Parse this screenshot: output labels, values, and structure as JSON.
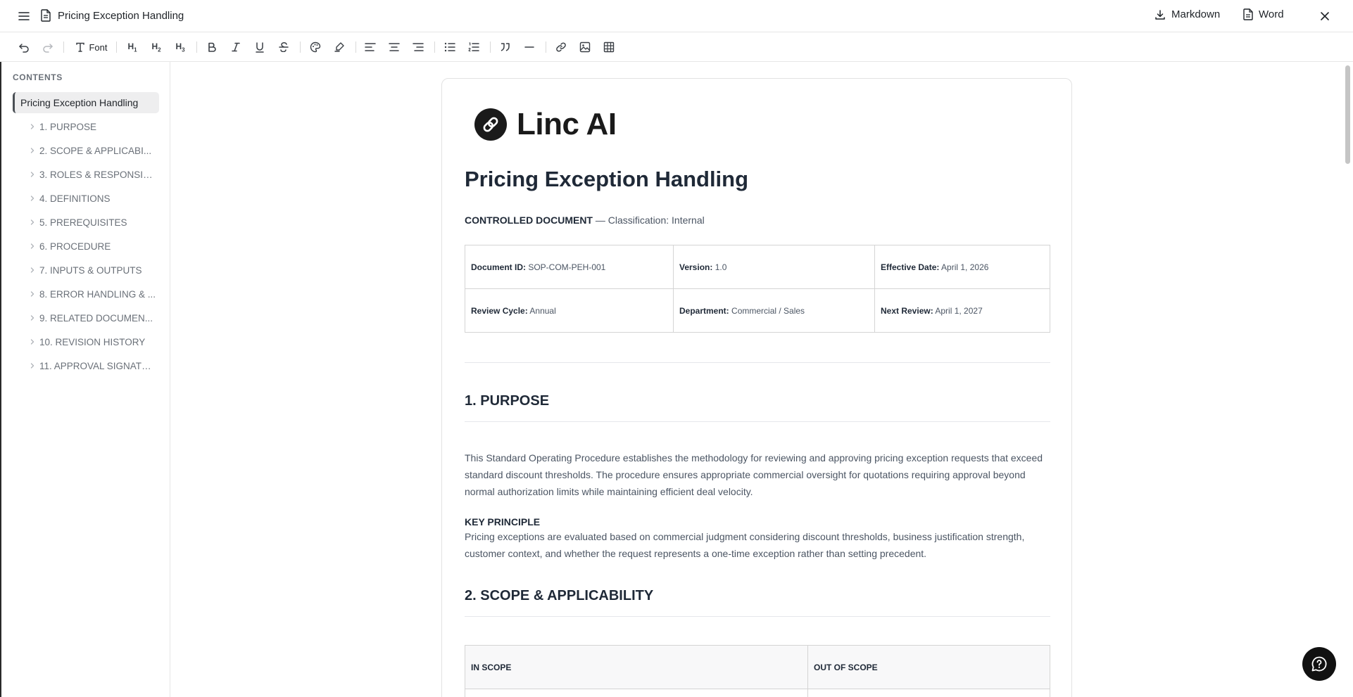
{
  "header": {
    "title": "Pricing Exception Handling",
    "markdown_label": "Markdown",
    "word_label": "Word"
  },
  "toolbar": {
    "font_label": "Font",
    "h1": "H",
    "h2": "H",
    "h3": "H",
    "h1_sub": "1",
    "h2_sub": "2",
    "h3_sub": "3"
  },
  "sidebar": {
    "heading": "CONTENTS",
    "active": "Pricing Exception Handling",
    "items": [
      {
        "label": "1. PURPOSE"
      },
      {
        "label": "2. SCOPE & APPLICABI..."
      },
      {
        "label": "3. ROLES & RESPONSIB..."
      },
      {
        "label": "4. DEFINITIONS"
      },
      {
        "label": "5. PREREQUISITES"
      },
      {
        "label": "6. PROCEDURE"
      },
      {
        "label": "7. INPUTS & OUTPUTS"
      },
      {
        "label": "8. ERROR HANDLING & ..."
      },
      {
        "label": "9. RELATED DOCUMEN..."
      },
      {
        "label": "10. REVISION HISTORY"
      },
      {
        "label": "11. APPROVAL SIGNATU..."
      }
    ]
  },
  "document": {
    "brand": "Linc AI",
    "title": "Pricing Exception Handling",
    "controlled_label": "CONTROLLED DOCUMENT",
    "classification": " — Classification: Internal",
    "meta": {
      "doc_id_label": "Document ID:",
      "doc_id": " SOP-COM-PEH-001",
      "version_label": "Version:",
      "version": " 1.0",
      "effective_label": "Effective Date:",
      "effective": " April 1, 2026",
      "review_label": "Review Cycle:",
      "review": " Annual",
      "dept_label": "Department:",
      "dept": " Commercial / Sales",
      "next_label": "Next Review:",
      "next": " April 1, 2027"
    },
    "purpose_heading": "1. PURPOSE",
    "purpose_text": "This Standard Operating Procedure establishes the methodology for reviewing and approving pricing exception requests that exceed standard discount thresholds. The procedure ensures appropriate commercial oversight for quotations requiring approval beyond normal authorization limits while maintaining efficient deal velocity.",
    "key_principle_title": "KEY PRINCIPLE",
    "key_principle_text": "Pricing exceptions are evaluated based on commercial judgment considering discount thresholds, business justification strength, customer context, and whether the request represents a one-time exception rather than setting precedent.",
    "scope_heading": "2. SCOPE & APPLICABILITY",
    "scope_table": {
      "in_scope": "IN SCOPE",
      "out_of_scope": "OUT OF SCOPE"
    }
  }
}
